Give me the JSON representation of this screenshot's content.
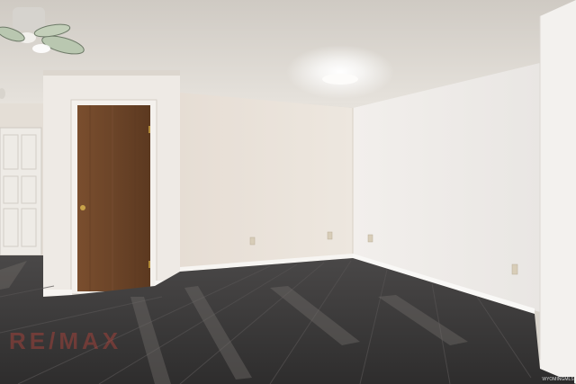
{
  "photo": {
    "subject": "empty room",
    "colors": {
      "ceiling": "#e4e0da",
      "wall": "#ece7e1",
      "right_wall": "#f0ede9",
      "door_wood": "#6b4428",
      "floor": "#3b3a3a"
    }
  },
  "watermark": {
    "text": "RE/MAX"
  },
  "badge": {
    "text": "WYOMINGMLS"
  }
}
